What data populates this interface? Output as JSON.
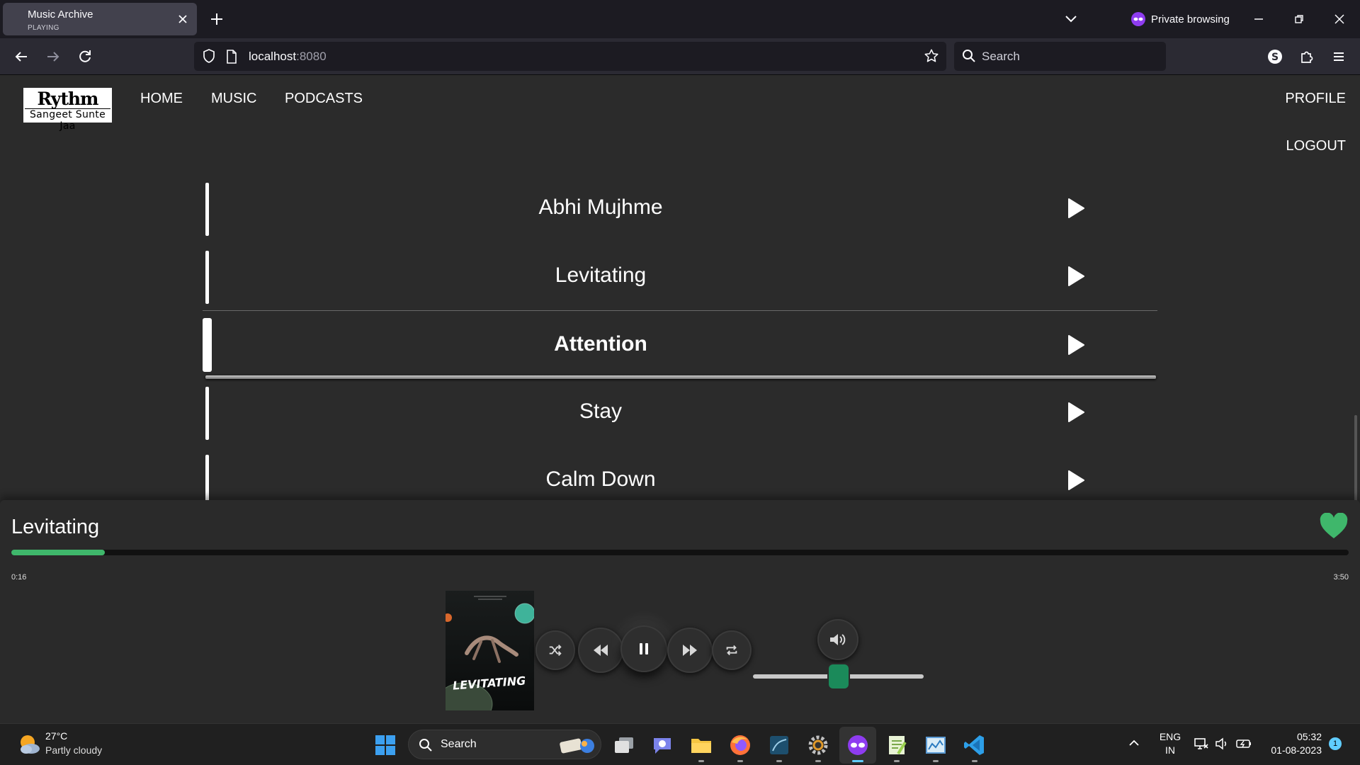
{
  "browser": {
    "tab_title": "Music Archive",
    "tab_subtitle": "PLAYING",
    "private_label": "Private browsing",
    "url_host": "localhost",
    "url_port": ":8080",
    "search_placeholder": "Search"
  },
  "site": {
    "logo_line1": "Rythm",
    "logo_line2": "Sangeet Sunte Jaa",
    "nav": [
      "HOME",
      "MUSIC",
      "PODCASTS"
    ],
    "profile": "PROFILE",
    "logout": "LOGOUT"
  },
  "tracks": [
    {
      "title": "Abhi Mujhme",
      "active": false
    },
    {
      "title": "Levitating",
      "active": false
    },
    {
      "title": "Attention",
      "active": true
    },
    {
      "title": "Stay",
      "active": false
    },
    {
      "title": "Calm Down",
      "active": false
    }
  ],
  "player": {
    "now_playing": "Levitating",
    "elapsed": "0:16",
    "duration": "3:50",
    "progress_fraction": 0.07,
    "volume_fraction": 0.5,
    "liked": true,
    "cover_text": "LEVITATING",
    "accent_color": "#3fb76b",
    "heart_color": "#3fb76b"
  },
  "taskbar": {
    "temperature": "27°C",
    "weather": "Partly cloudy",
    "search_placeholder": "Search",
    "lang": "ENG",
    "region": "IN",
    "time": "05:32",
    "date": "01-08-2023",
    "notification_count": "1"
  }
}
